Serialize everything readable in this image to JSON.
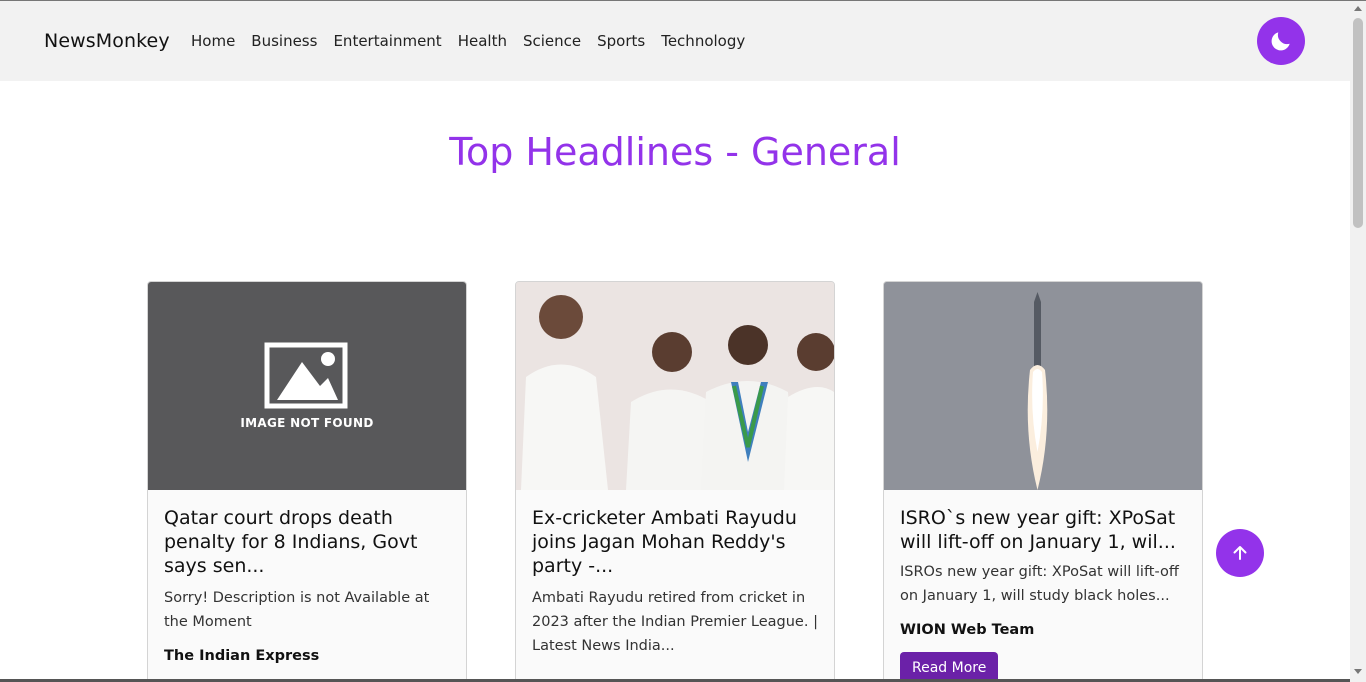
{
  "navbar": {
    "brand": "NewsMonkey",
    "links": [
      "Home",
      "Business",
      "Entertainment",
      "Health",
      "Science",
      "Sports",
      "Technology"
    ],
    "theme_icon": "moon-icon"
  },
  "page": {
    "title": "Top Headlines - General"
  },
  "cards": [
    {
      "image_text": "IMAGE NOT FOUND",
      "title": "Qatar court drops death penalty for 8 Indians, Govt says sen...",
      "description": "Sorry! Description is not Available at the Moment",
      "source": "The Indian Express"
    },
    {
      "title": "Ex-cricketer Ambati Rayudu joins Jagan Mohan Reddy's party -...",
      "description": "Ambati Rayudu retired from cricket in 2023 after the Indian Premier League. | Latest News India...",
      "source": ""
    },
    {
      "title": "ISRO`s new year gift: XPoSat will lift-off on January 1, wil...",
      "description": "ISROs new year gift: XPoSat will lift-off on January 1, will study black holes...",
      "source": "WION Web Team",
      "button": "Read More"
    }
  ],
  "scroll_top_icon": "arrow-up-icon",
  "colors": {
    "accent": "#9333ea",
    "button": "#6b21a8",
    "navbar_bg": "#f2f2f2"
  }
}
